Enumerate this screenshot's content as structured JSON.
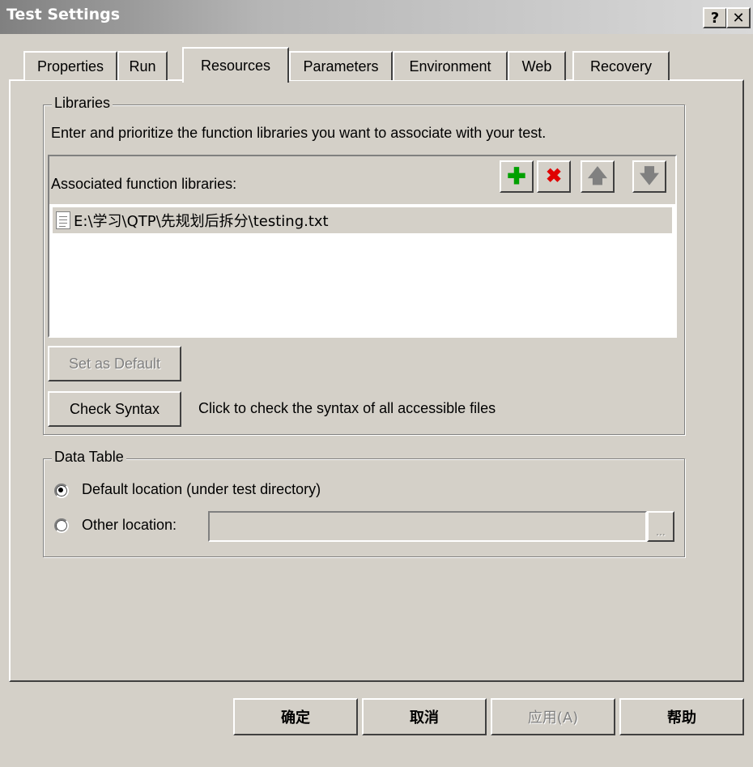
{
  "window": {
    "title": "Test Settings",
    "help_label": "?",
    "close_label": "✕"
  },
  "tabs": [
    {
      "label": "Properties",
      "active": false
    },
    {
      "label": "Run",
      "active": false
    },
    {
      "label": "Resources",
      "active": true
    },
    {
      "label": "Parameters",
      "active": false
    },
    {
      "label": "Environment",
      "active": false
    },
    {
      "label": "Web",
      "active": false
    },
    {
      "label": "Recovery",
      "active": false
    }
  ],
  "libraries": {
    "legend": "Libraries",
    "description": "Enter and prioritize the function libraries you want to associate with your test.",
    "list_label": "Associated function libraries:",
    "toolbar": {
      "add_icon": "plus-icon",
      "remove_icon": "delete-x-icon",
      "up_icon": "arrow-up-icon",
      "down_icon": "arrow-down-icon",
      "add_color": "#00a000",
      "remove_color": "#e00000"
    },
    "items": [
      {
        "path": "E:\\学习\\QTP\\先规划后拆分\\testing.txt",
        "icon": "text-file-icon"
      }
    ],
    "set_default_label": "Set as Default",
    "check_syntax_label": "Check Syntax",
    "check_syntax_hint": "Click to check the syntax of all accessible files"
  },
  "data_table": {
    "legend": "Data Table",
    "default_location_label": "Default location (under test directory)",
    "other_location_label": "Other location:",
    "other_location_value": "",
    "browse_label": "...",
    "selected": "default"
  },
  "footer": {
    "ok_label": "确定",
    "cancel_label": "取消",
    "apply_label": "应用(A)",
    "help_label": "帮助"
  }
}
